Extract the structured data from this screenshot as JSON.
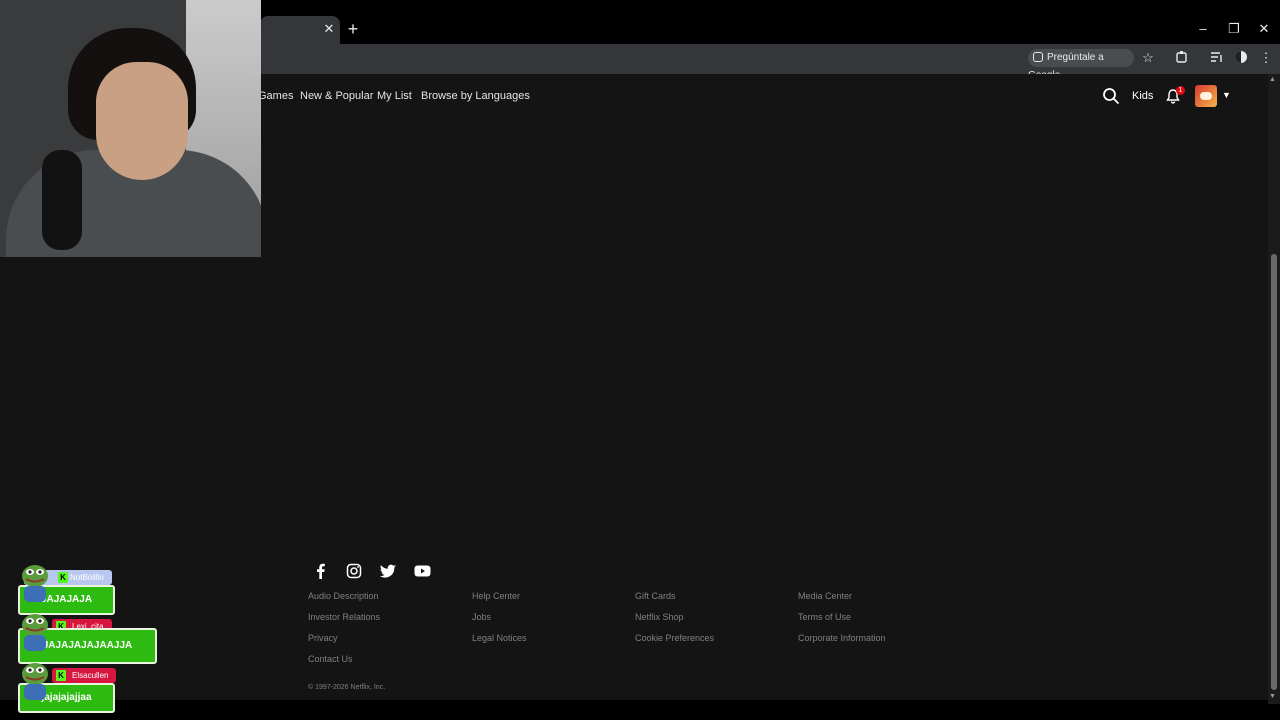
{
  "browser": {
    "tab_close": "✕",
    "new_tab": "+",
    "window": {
      "minimize": "–",
      "restore": "❐",
      "close": "✕"
    },
    "ask_google": "Pregúntale a Google",
    "toolbar_icons": [
      "star-icon",
      "extensions-icon",
      "media-icon",
      "profile-icon",
      "menu-icon"
    ]
  },
  "netflix": {
    "nav": {
      "links": [
        "Games",
        "New & Popular",
        "My List",
        "Browse by Languages"
      ],
      "kids": "Kids",
      "notification_count": "1"
    },
    "footer": {
      "social": [
        "facebook-icon",
        "instagram-icon",
        "twitter-icon",
        "youtube-icon"
      ],
      "columns": [
        [
          "Audio Description",
          "Investor Relations",
          "Privacy",
          "Contact Us"
        ],
        [
          "Help Center",
          "Jobs",
          "Legal Notices"
        ],
        [
          "Gift Cards",
          "Netflix Shop",
          "Cookie Preferences"
        ],
        [
          "Media Center",
          "Terms of Use",
          "Corporate Information"
        ]
      ],
      "copyright": "© 1997-2026 Netflix, Inc."
    }
  },
  "stream_overlay": {
    "chat": [
      {
        "user": "NotBolillo",
        "message": "JAJAJAJA",
        "name_color": "#b9c7f0"
      },
      {
        "user": "Lexi_cita",
        "message": "JAJAJAJAJAAJJA",
        "name_color": "#d6163e"
      },
      {
        "user": "Elsacullen",
        "message": "jajajajajjaa",
        "name_color": "#d6163e"
      }
    ]
  },
  "colors": {
    "netflix_bg": "#141014",
    "badge_red": "#e50914",
    "chat_green": "#2dbb12",
    "kick_green": "#53fc18"
  }
}
